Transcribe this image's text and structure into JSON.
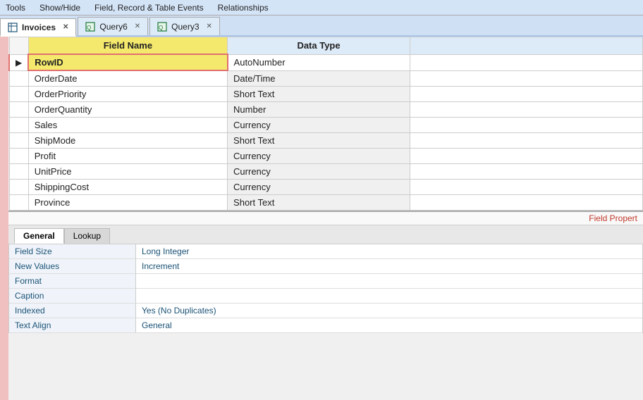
{
  "toolbar": {
    "items": [
      "Tools",
      "Show/Hide",
      "Field, Record & Table Events",
      "Relationships"
    ]
  },
  "tabs": [
    {
      "id": "invoices",
      "label": "Invoices",
      "active": true,
      "icon": "table-icon"
    },
    {
      "id": "query6",
      "label": "Query6",
      "active": false,
      "icon": "query-icon"
    },
    {
      "id": "query3",
      "label": "Query3",
      "active": false,
      "icon": "query-icon"
    }
  ],
  "field_table": {
    "headers": [
      "Field Name",
      "Data Type"
    ],
    "rows": [
      {
        "field": "RowID",
        "datatype": "AutoNumber",
        "selected": true
      },
      {
        "field": "OrderDate",
        "datatype": "Date/Time",
        "selected": false
      },
      {
        "field": "OrderPriority",
        "datatype": "Short Text",
        "selected": false
      },
      {
        "field": "OrderQuantity",
        "datatype": "Number",
        "selected": false
      },
      {
        "field": "Sales",
        "datatype": "Currency",
        "selected": false
      },
      {
        "field": "ShipMode",
        "datatype": "Short Text",
        "selected": false
      },
      {
        "field": "Profit",
        "datatype": "Currency",
        "selected": false
      },
      {
        "field": "UnitPrice",
        "datatype": "Currency",
        "selected": false
      },
      {
        "field": "ShippingCost",
        "datatype": "Currency",
        "selected": false
      },
      {
        "field": "Province",
        "datatype": "Short Text",
        "selected": false
      }
    ]
  },
  "field_properties": {
    "header_label": "Field Propert",
    "tabs": [
      "General",
      "Lookup"
    ],
    "active_tab": "General",
    "properties": [
      {
        "label": "Field Size",
        "value": "Long Integer"
      },
      {
        "label": "New Values",
        "value": "Increment"
      },
      {
        "label": "Format",
        "value": ""
      },
      {
        "label": "Caption",
        "value": ""
      },
      {
        "label": "Indexed",
        "value": "Yes (No Duplicates)"
      },
      {
        "label": "Text Align",
        "value": "General"
      }
    ]
  }
}
